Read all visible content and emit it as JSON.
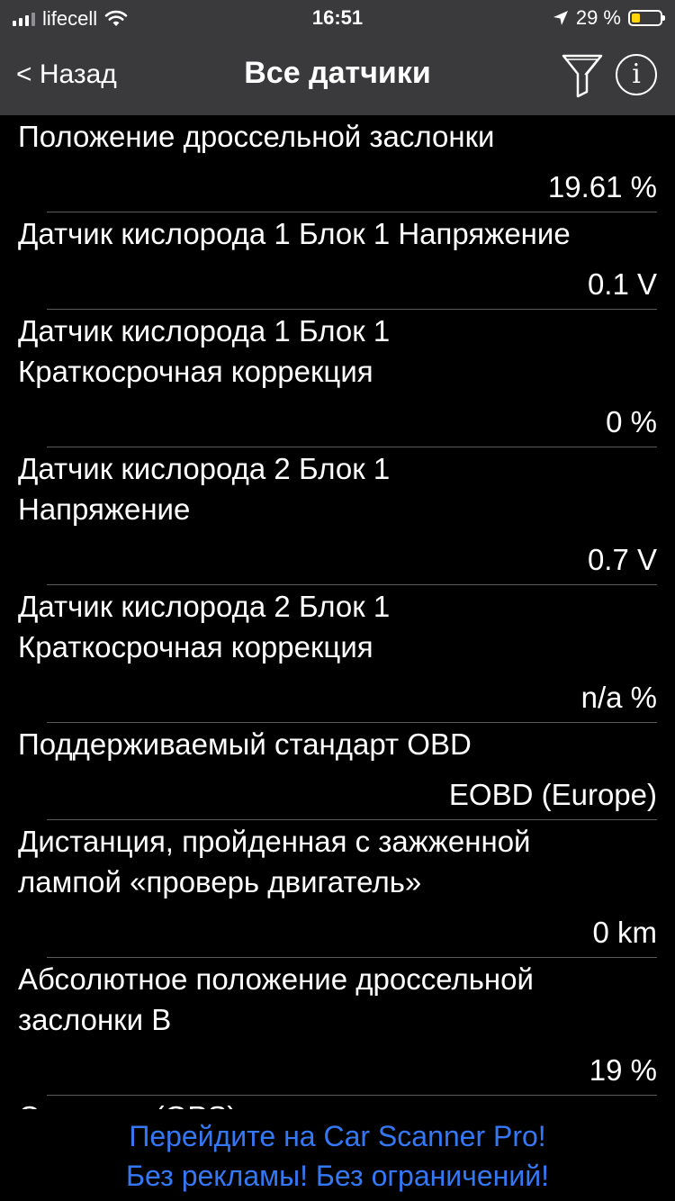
{
  "status_bar": {
    "carrier": "lifecell",
    "time": "16:51",
    "battery_percent": "29 %",
    "battery_level": 0.29
  },
  "nav": {
    "back_label": "< Назад",
    "title": "Все датчики",
    "filter_icon": "filter-icon",
    "info_icon": "info-icon",
    "info_glyph": "i"
  },
  "sensors": [
    {
      "label": "Положение дроссельной заслонки",
      "value": "19.61 %"
    },
    {
      "label": "Датчик кислорода 1 Блок 1 Напряжение",
      "value": "0.1 V"
    },
    {
      "label": "Датчик кислорода 1 Блок 1 Краткосрочная коррекция",
      "value": "0 %"
    },
    {
      "label": "Датчик кислорода 2 Блок 1 Напряжение",
      "value": "0.7 V"
    },
    {
      "label": "Датчик кислорода 2 Блок 1 Краткосрочная коррекция",
      "value": "n/a %"
    },
    {
      "label": "Поддерживаемый стандарт OBD",
      "value": "EOBD (Europe)"
    },
    {
      "label": "Дистанция, пройденная с зажженной лампой «проверь двигатель»",
      "value": "0 km"
    },
    {
      "label": "Абсолютное положение дроссельной заслонки B",
      "value": "19 %"
    },
    {
      "label": "Скорость (GPS)",
      "value": ""
    }
  ],
  "promo": {
    "line1": "Перейдите на Car Scanner Pro!",
    "line2": "Без рекламы! Без ограничений!",
    "color": "#3478f6"
  },
  "colors": {
    "nav_background": "#3a3a3c",
    "background": "#000000",
    "battery": "#ffd60a"
  }
}
